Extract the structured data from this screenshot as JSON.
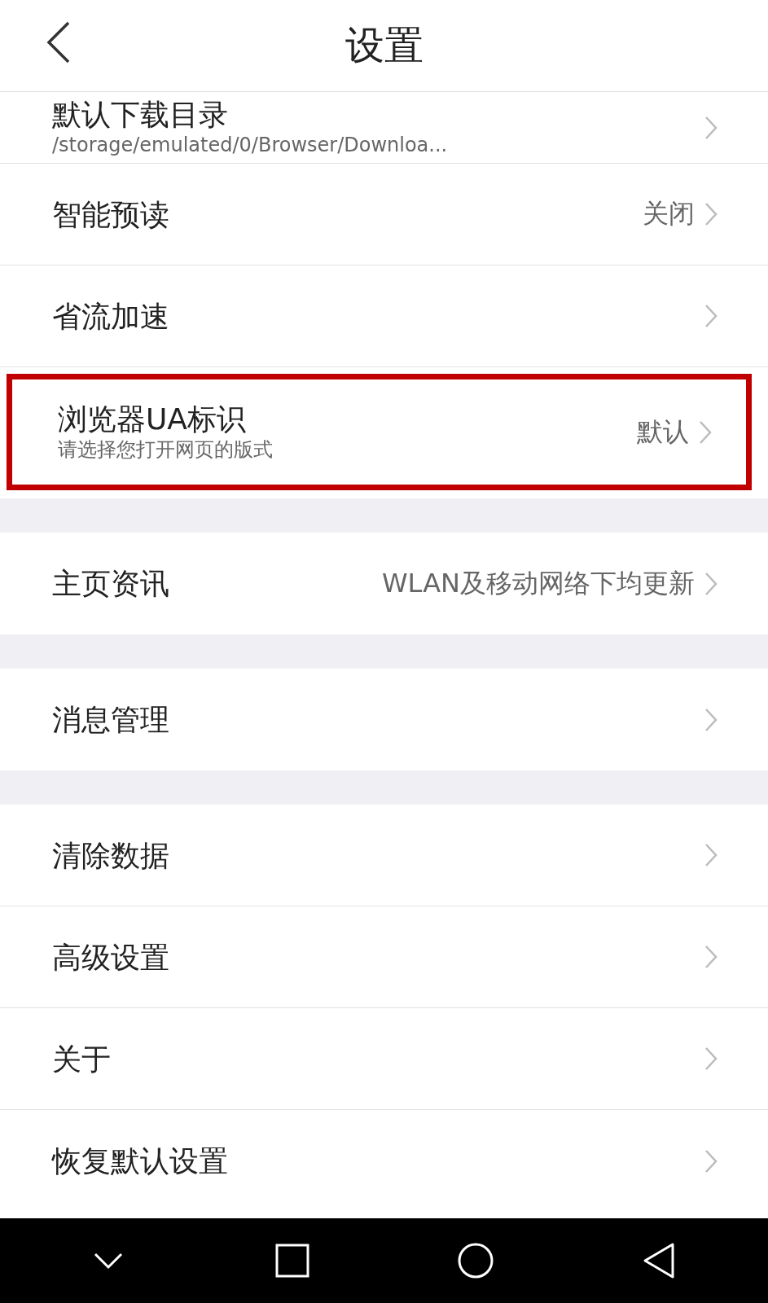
{
  "header": {
    "title": "设置"
  },
  "groups": [
    {
      "items": [
        {
          "title": "默认下载目录",
          "subtitle": "/storage/emulated/0/Browser/Downloa...",
          "highlighted": false
        },
        {
          "title": "智能预读",
          "value": "关闭",
          "highlighted": false
        },
        {
          "title": "省流加速",
          "highlighted": false
        },
        {
          "title": "浏览器UA标识",
          "subtitle": "请选择您打开网页的版式",
          "value": "默认",
          "highlighted": true
        }
      ]
    },
    {
      "items": [
        {
          "title": "主页资讯",
          "value": "WLAN及移动网络下均更新",
          "highlighted": false
        }
      ]
    },
    {
      "items": [
        {
          "title": "消息管理",
          "highlighted": false
        }
      ]
    },
    {
      "items": [
        {
          "title": "清除数据",
          "highlighted": false
        },
        {
          "title": "高级设置",
          "highlighted": false
        },
        {
          "title": "关于",
          "highlighted": false
        },
        {
          "title": "恢复默认设置",
          "highlighted": false
        }
      ]
    }
  ]
}
